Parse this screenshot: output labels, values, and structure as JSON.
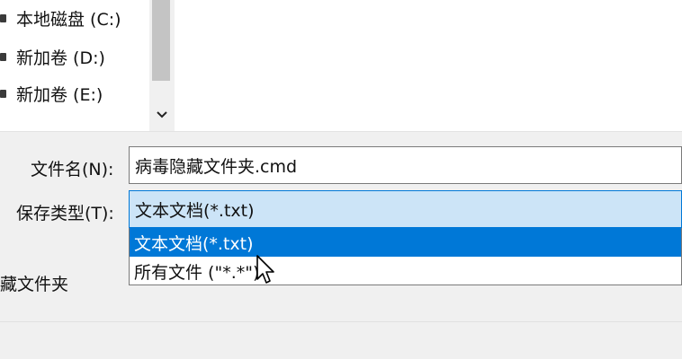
{
  "tree": {
    "items": [
      {
        "label": "本地磁盘 (C:)",
        "icon": "drive-icon"
      },
      {
        "label": "新加卷 (D:)",
        "icon": "drive-icon"
      },
      {
        "label": "新加卷 (E:)",
        "icon": "drive-icon"
      }
    ],
    "scroll_down_icon": "chevron-down-icon"
  },
  "form": {
    "filename_label": "文件名(N):",
    "filename_value": "病毒隐藏文件夹.cmd",
    "savetype_label": "保存类型(T):",
    "savetype_value": "文本文档(*.txt)",
    "options": [
      {
        "label": "文本文档(*.txt)",
        "selected": true
      },
      {
        "label": "所有文件 (\"*.*\")",
        "selected": false
      }
    ],
    "folder_label": "藏文件夹"
  },
  "colors": {
    "selection": "#0078d7",
    "focus_fill": "#cce4f7"
  }
}
